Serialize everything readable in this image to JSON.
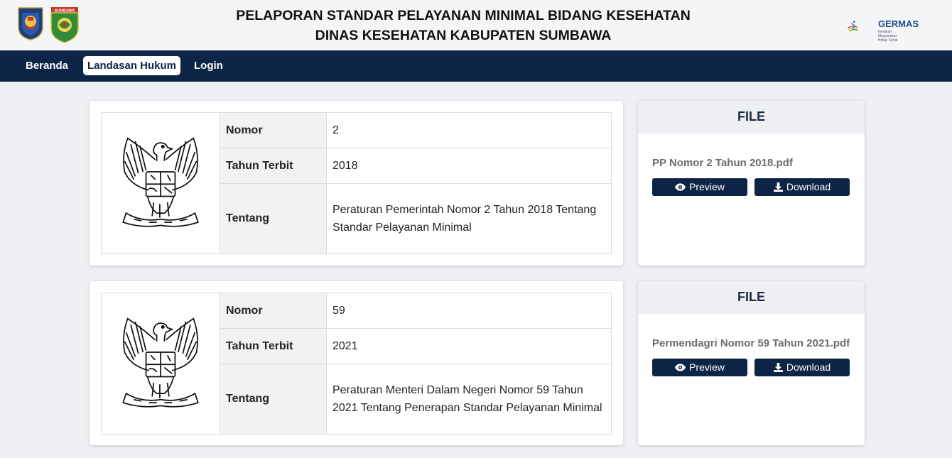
{
  "header": {
    "title_line1": "PELAPORAN STANDAR PELAYANAN MINIMAL BIDANG KESEHATAN",
    "title_line2": "DINAS KESEHATAN KABUPATEN SUMBAWA",
    "sumbawa_logo_text": "SUMBAWA",
    "germas_logo": "GERMAS",
    "germas_tagline": "Gerakan Masyarakat Hidup Sehat"
  },
  "nav": {
    "items": [
      {
        "label": "Beranda",
        "active": false
      },
      {
        "label": "Landasan Hukum",
        "active": true
      },
      {
        "label": "Login",
        "active": false
      }
    ]
  },
  "documents": [
    {
      "emblem_icon": "garuda-pancasila-icon",
      "nomor_label": "Nomor",
      "nomor": "2",
      "tahun_label": "Tahun Terbit",
      "tahun": "2018",
      "tentang_label": "Tentang",
      "tentang": "Peraturan Pemerintah Nomor 2 Tahun 2018 Tentang Standar Pelayanan Minimal",
      "file_heading": "FILE",
      "file_name": "PP Nomor 2 Tahun 2018.pdf",
      "preview_label": "Preview",
      "download_label": "Download"
    },
    {
      "emblem_icon": "garuda-pancasila-icon",
      "nomor_label": "Nomor",
      "nomor": "59",
      "tahun_label": "Tahun Terbit",
      "tahun": "2021",
      "tentang_label": "Tentang",
      "tentang": "Peraturan Menteri Dalam Negeri Nomor 59 Tahun 2021 Tentang Penerapan Standar Pelayanan Minimal",
      "file_heading": "FILE",
      "file_name": "Permendagri Nomor 59 Tahun 2021.pdf",
      "preview_label": "Preview",
      "download_label": "Download"
    }
  ],
  "colors": {
    "navy": "#0c2445",
    "page_bg": "#eef0f3",
    "label_bg": "#f2f2f2"
  }
}
